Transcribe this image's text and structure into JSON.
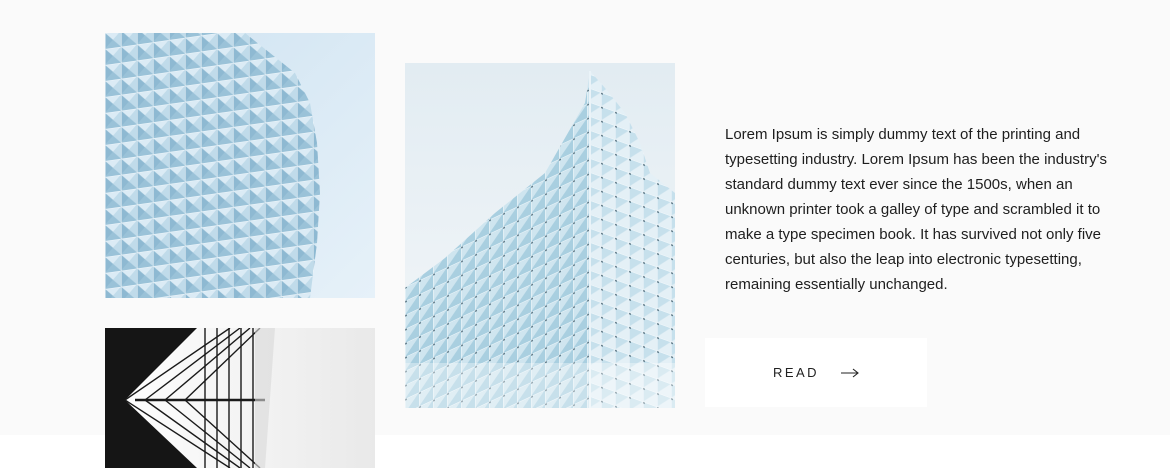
{
  "images": [
    {
      "alt": "glass-facade-building-photo"
    },
    {
      "alt": "glass-tower-corner-photo"
    },
    {
      "alt": "black-white-building-abstract-photo"
    }
  ],
  "article": {
    "body": "Lorem Ipsum is simply dummy text of the printing and typesetting industry. Lorem Ipsum has been the industry's standard dummy text ever since the 1500s, when an unknown printer took a galley of type and scrambled it to make a type specimen book. It has survived not only five centuries, but also the leap into electronic typesetting, remaining essentially unchanged."
  },
  "read_button": {
    "label": "READ",
    "icon": "arrow-right-icon"
  },
  "colors": {
    "section_background": "#fafafa",
    "text": "#1e1e1e",
    "glass_blue": "#a8cfe3",
    "sky": "#dcecf7"
  }
}
